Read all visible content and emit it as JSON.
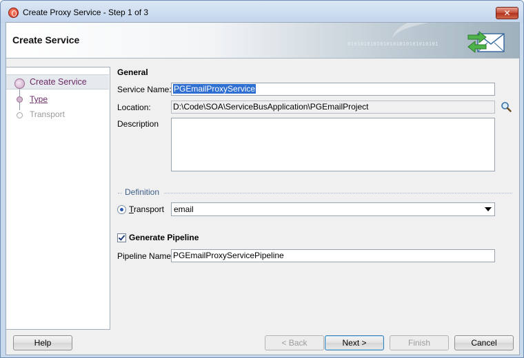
{
  "window": {
    "title": "Create Proxy Service - Step 1 of 3",
    "close_label": "✕"
  },
  "banner": {
    "title": "Create Service",
    "binary_text": "0101010101010101010101010101",
    "icon": "envelope-exchange-icon"
  },
  "nav": {
    "items": [
      {
        "label": "Create Service",
        "state": "active"
      },
      {
        "label": "Type",
        "state": "link"
      },
      {
        "label": "Transport",
        "state": "disabled"
      }
    ]
  },
  "general": {
    "heading": "General",
    "service_name_label": "Service Name:",
    "service_name_value": "PGEmailProxyService",
    "location_label": "Location:",
    "location_value": "D:\\Code\\SOA\\ServiceBusApplication\\PGEmailProject",
    "description_label": "Description",
    "description_value": ""
  },
  "definition": {
    "heading": "Definition",
    "transport_label": "Transport",
    "transport_value": "email"
  },
  "pipeline": {
    "generate_label": "Generate Pipeline",
    "generate_checked": true,
    "name_label": "Pipeline Name:",
    "name_value": "PGEmailProxyServicePipeline"
  },
  "buttons": {
    "help": "Help",
    "back": "< Back",
    "next": "Next >",
    "finish": "Finish",
    "cancel": "Cancel"
  },
  "colors": {
    "accent_purple": "#6b2a66",
    "selection_blue": "#2f6fd1",
    "definition_blue": "#3d5e8a"
  }
}
